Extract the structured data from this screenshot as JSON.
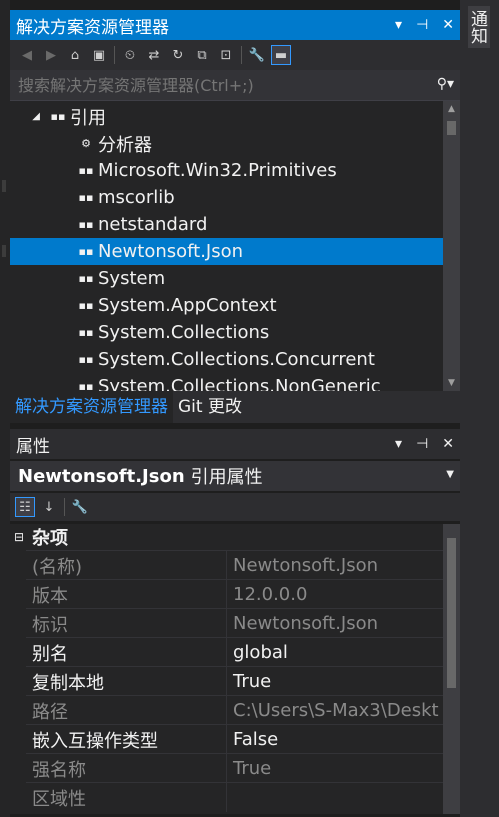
{
  "solution_explorer": {
    "title": "解决方案资源管理器",
    "title_buttons": [
      "▾",
      "⊣",
      "✕"
    ],
    "search_placeholder": "搜索解决方案资源管理器(Ctrl+;)",
    "tree": [
      {
        "label": "引用",
        "icon": "▪▪",
        "toggle": "◢",
        "indent": 30
      },
      {
        "label": "分析器",
        "icon": "⚙",
        "indent": 66
      },
      {
        "label": "Microsoft.Win32.Primitives",
        "icon": "▪▪",
        "indent": 66
      },
      {
        "label": "mscorlib",
        "icon": "▪▪",
        "indent": 66
      },
      {
        "label": "netstandard",
        "icon": "▪▪",
        "indent": 66
      },
      {
        "label": "Newtonsoft.Json",
        "icon": "▪▪",
        "indent": 66,
        "selected": true
      },
      {
        "label": "System",
        "icon": "▪▪",
        "indent": 66
      },
      {
        "label": "System.AppContext",
        "icon": "▪▪",
        "indent": 66
      },
      {
        "label": "System.Collections",
        "icon": "▪▪",
        "indent": 66
      },
      {
        "label": "System.Collections.Concurrent",
        "icon": "▪▪",
        "indent": 66
      },
      {
        "label": "System.Collections.NonGeneric",
        "icon": "▪▪",
        "indent": 66
      }
    ],
    "tabs": [
      "解决方案资源管理器",
      "Git 更改"
    ]
  },
  "properties": {
    "title": "属性",
    "object_name": "Newtonsoft.Json",
    "object_kind": "引用属性",
    "category": "杂项",
    "rows": [
      {
        "key": "(名称)",
        "value": "Newtonsoft.Json",
        "readonly": true
      },
      {
        "key": "版本",
        "value": "12.0.0.0",
        "readonly": true
      },
      {
        "key": "标识",
        "value": "Newtonsoft.Json",
        "readonly": true
      },
      {
        "key": "别名",
        "value": "global",
        "readonly": false
      },
      {
        "key": "复制本地",
        "value": "True",
        "readonly": false
      },
      {
        "key": "路径",
        "value": "C:\\Users\\S-Max3\\Deskt",
        "readonly": true
      },
      {
        "key": "嵌入互操作类型",
        "value": "False",
        "readonly": false
      },
      {
        "key": "强名称",
        "value": "True",
        "readonly": true
      },
      {
        "key": "区域性",
        "value": "",
        "readonly": true
      }
    ]
  },
  "right_strip": {
    "label": "通知"
  }
}
